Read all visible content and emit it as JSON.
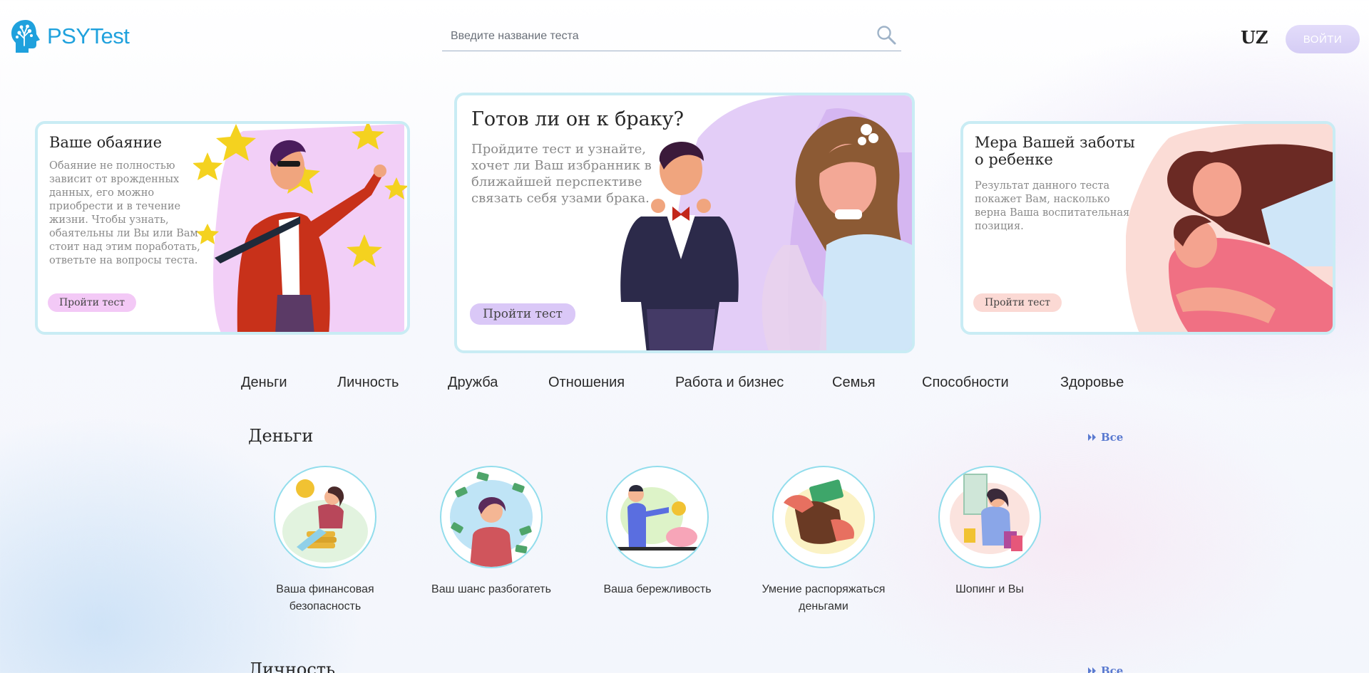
{
  "header": {
    "logo_text": "PSYTest",
    "search_placeholder": "Введите название теста",
    "lang": "UZ",
    "login_label": "ВОЙТИ"
  },
  "cards": [
    {
      "title": "Ваше обаяние",
      "desc": "Обаяние не полностью зависит от врожденных данных, его можно приобрести и в течение жизни. Чтобы узнать, обаятельны ли Вы или Вам стоит над этим поработать, ответьте на вопросы теста.",
      "button": "Пройти тест"
    },
    {
      "title": "Готов ли он к браку?",
      "desc": "Пройдите тест и узнайте, хочет ли Ваш избранник в ближайшей перспективе связать себя узами брака.",
      "button": "Пройти тест"
    },
    {
      "title": "Мера Вашей заботы о ребенке",
      "desc": "Результат данного теста покажет Вам, насколько верна Ваша воспитательная позиция.",
      "button": "Пройти тест"
    }
  ],
  "categories": [
    "Деньги",
    "Личность",
    "Дружба",
    "Отношения",
    "Работа и бизнес",
    "Семья",
    "Способности",
    "Здоровье"
  ],
  "sections": [
    {
      "title": "Деньги",
      "all_label": "Все",
      "tests": [
        {
          "name": "Ваша финансовая безопасность"
        },
        {
          "name": "Ваш шанс разбогатеть"
        },
        {
          "name": "Ваша бережливость"
        },
        {
          "name": "Умение распоряжаться деньгами"
        },
        {
          "name": "Шопинг и Вы"
        }
      ]
    },
    {
      "title": "Личность",
      "all_label": "Все"
    }
  ],
  "colors": {
    "brand": "#1fa1dd",
    "card_border": "#c9ecf4",
    "circle_border": "#92ddec",
    "link": "#5a7ad0",
    "login_button": "#d5cdf5"
  },
  "icons": [
    "brain-tree-logo-icon",
    "search-icon",
    "double-chevron-right-icon"
  ]
}
